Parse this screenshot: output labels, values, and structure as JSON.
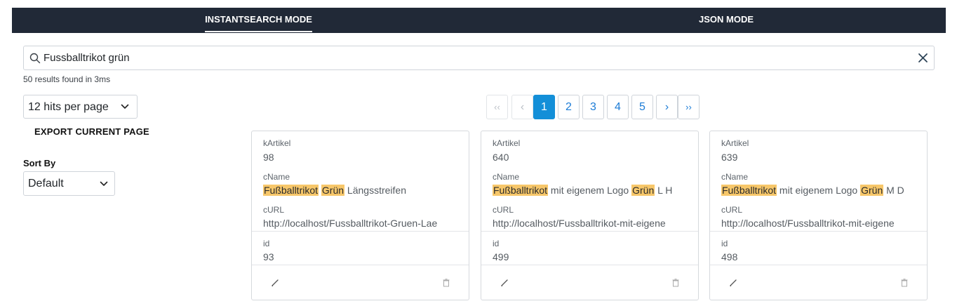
{
  "tabs": [
    {
      "label": "INSTANTSEARCH MODE",
      "active": true
    },
    {
      "label": "JSON MODE",
      "active": false
    }
  ],
  "search": {
    "value": "Fussballtrikot grün",
    "placeholder": ""
  },
  "stats": "50 results found in 3ms",
  "hits_per_page": {
    "selected": "12 hits per page"
  },
  "export_label": "EXPORT CURRENT PAGE",
  "sort": {
    "label": "Sort By",
    "selected": "Default"
  },
  "pagination": {
    "first": "‹‹",
    "prev": "‹",
    "next": "›",
    "last": "››",
    "pages": [
      "1",
      "2",
      "3",
      "4",
      "5"
    ],
    "current": "1"
  },
  "field_labels": {
    "kArtikel": "kArtikel",
    "cName": "cName",
    "cURL": "cURL",
    "id": "id"
  },
  "hits": [
    {
      "kArtikel": "98",
      "cName": [
        {
          "t": "Fußballtrikot",
          "hl": true
        },
        {
          "t": " ",
          "hl": false
        },
        {
          "t": "Grün",
          "hl": true
        },
        {
          "t": " Längsstreifen",
          "hl": false
        }
      ],
      "cURL": "http://localhost/Fussballtrikot-Gruen-Lae",
      "id": "93"
    },
    {
      "kArtikel": "640",
      "cName": [
        {
          "t": "Fußballtrikot",
          "hl": true
        },
        {
          "t": " mit eigenem Logo ",
          "hl": false
        },
        {
          "t": "Grün",
          "hl": true
        },
        {
          "t": " L H",
          "hl": false
        }
      ],
      "cURL": "http://localhost/Fussballtrikot-mit-eigene",
      "id": "499"
    },
    {
      "kArtikel": "639",
      "cName": [
        {
          "t": "Fußballtrikot",
          "hl": true
        },
        {
          "t": " mit eigenem Logo ",
          "hl": false
        },
        {
          "t": "Grün",
          "hl": true
        },
        {
          "t": " M D",
          "hl": false
        }
      ],
      "cURL": "http://localhost/Fussballtrikot-mit-eigene",
      "id": "498"
    }
  ],
  "icons": {
    "search": "search-icon",
    "clear": "close-icon",
    "edit": "pencil-icon",
    "delete": "trash-icon",
    "select": "chevron-down-icon"
  },
  "colors": {
    "topbar": "#212937",
    "highlight": "#f7c76a",
    "active_page": "#138fd8",
    "link": "#1c7cd6"
  }
}
